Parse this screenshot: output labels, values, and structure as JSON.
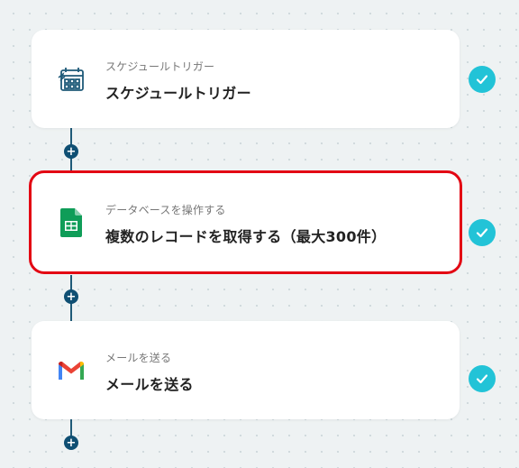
{
  "steps": [
    {
      "subtitle": "スケジュールトリガー",
      "title": "スケジュールトリガー",
      "icon": "calendar-clock-icon",
      "status": "completed"
    },
    {
      "subtitle": "データベースを操作する",
      "title": "複数のレコードを取得する（最大300件）",
      "icon": "google-sheets-icon",
      "status": "completed",
      "selected": true
    },
    {
      "subtitle": "メールを送る",
      "title": "メールを送る",
      "icon": "gmail-icon",
      "status": "completed"
    }
  ],
  "add_step_label": "+",
  "colors": {
    "check": "#22c3d7",
    "highlight": "#e30613",
    "connector": "#1f5a78",
    "sheets": "#0f9d58"
  }
}
